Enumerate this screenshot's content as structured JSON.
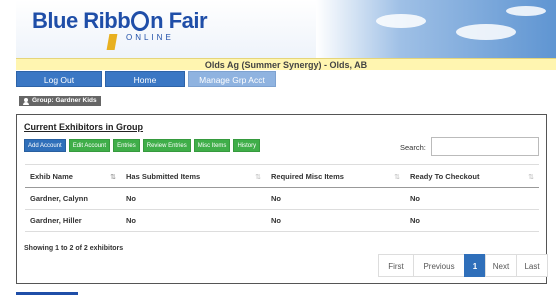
{
  "brand": {
    "name_part1": "Blue Ribb",
    "name_part2": "n Fair",
    "subtitle": "ONLINE"
  },
  "event_title": "Olds Ag (Summer Synergy) - Olds, AB",
  "nav": {
    "logout_label": "Log Out",
    "home_label": "Home",
    "manage_label": "Manage Grp Acct"
  },
  "group": {
    "label": "Group: Gardner Kids",
    "icon": "user-icon"
  },
  "panel": {
    "title": "Current Exhibitors in Group",
    "actions": [
      "Add Account",
      "Edit Account",
      "Entries",
      "Review Entries",
      "Misc Items",
      "History"
    ],
    "search_label": "Search:",
    "search_value": ""
  },
  "table": {
    "headers": [
      "Exhib Name",
      "Has Submitted Items",
      "Required Misc Items",
      "Ready To Checkout"
    ],
    "rows": [
      [
        "Gardner, Calynn",
        "No",
        "No",
        "No"
      ],
      [
        "Gardner, Hiller",
        "No",
        "No",
        "No"
      ]
    ]
  },
  "info": "Showing 1 to 2 of 2 exhibitors",
  "pagination": {
    "first": "First",
    "previous": "Previous",
    "page": "1",
    "next": "Next",
    "last": "Last"
  },
  "colors": {
    "primary": "#2f6fba",
    "success": "#3fae49",
    "event_bar": "#fff5b0"
  }
}
